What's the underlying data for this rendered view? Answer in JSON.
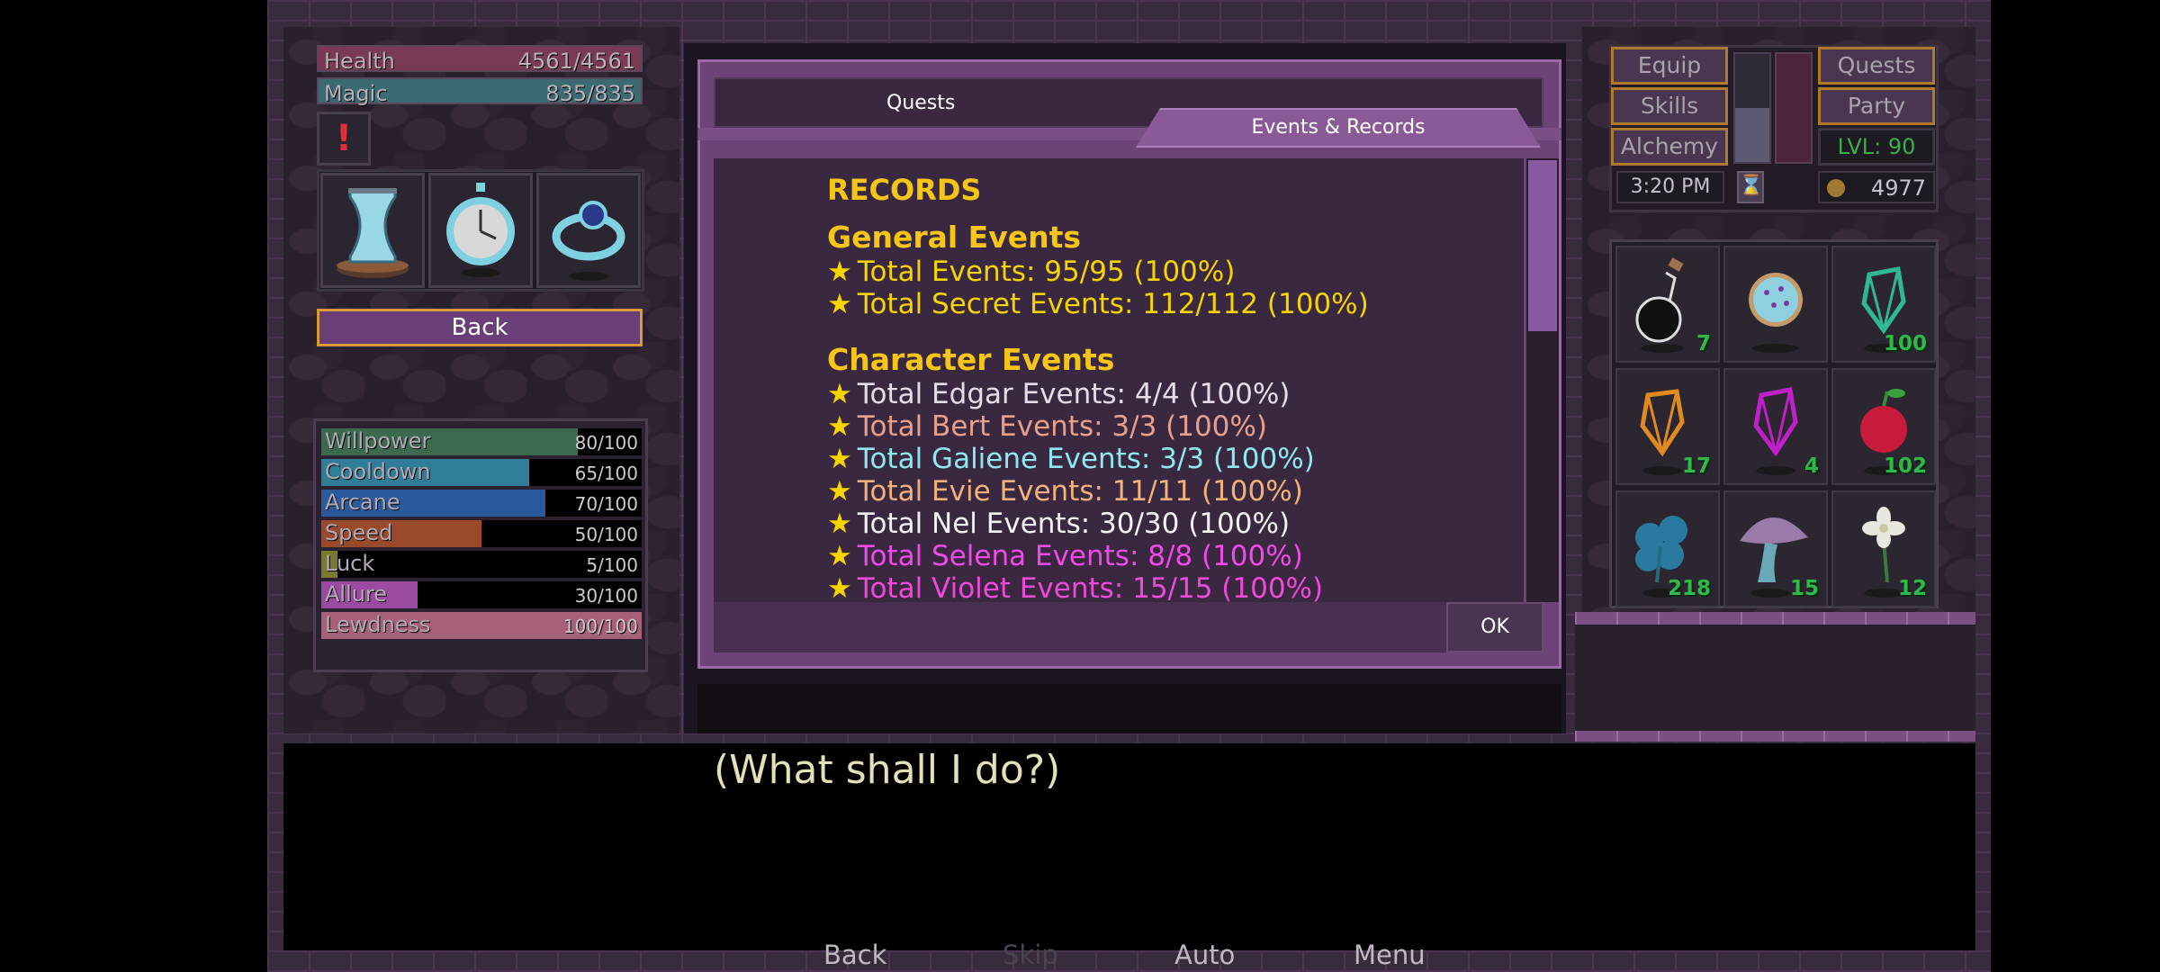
{
  "status": {
    "health": {
      "label": "Health",
      "value": "4561/4561",
      "fraction": 1.0,
      "color": "#7a3a55"
    },
    "magic": {
      "label": "Magic",
      "value": "835/835",
      "fraction": 1.0,
      "color": "#3c6a72"
    },
    "alert_icon": "exclamation-icon"
  },
  "equipped_items": [
    "hourglass-icon",
    "stopwatch-icon",
    "ring-icon"
  ],
  "back_button": "Back",
  "stats": [
    {
      "label": "Willpower",
      "value": "80/100",
      "fraction": 0.8,
      "color": "#3b6a4f"
    },
    {
      "label": "Cooldown",
      "value": "65/100",
      "fraction": 0.65,
      "color": "#2f7d96"
    },
    {
      "label": "Arcane",
      "value": "70/100",
      "fraction": 0.7,
      "color": "#2a5a9c"
    },
    {
      "label": "Speed",
      "value": "50/100",
      "fraction": 0.5,
      "color": "#9a4a2a"
    },
    {
      "label": "Luck",
      "value": "5/100",
      "fraction": 0.05,
      "color": "#7a7a30"
    },
    {
      "label": "Allure",
      "value": "30/100",
      "fraction": 0.3,
      "color": "#9a4aa0"
    },
    {
      "label": "Lewdness",
      "value": "100/100",
      "fraction": 1.0,
      "color": "#a6607a"
    }
  ],
  "right_menu": {
    "equip": "Equip",
    "quests": "Quests",
    "skills": "Skills",
    "party": "Party",
    "alchemy": "Alchemy",
    "level": "LVL: 90",
    "time": "3:20 PM",
    "gold": "4977"
  },
  "inventory": [
    {
      "icon": "potion-flask-icon",
      "count": "7"
    },
    {
      "icon": "cookie-icon",
      "count": ""
    },
    {
      "icon": "green-crystal-icon",
      "count": "100"
    },
    {
      "icon": "orange-crystal-icon",
      "count": "17"
    },
    {
      "icon": "purple-crystal-icon",
      "count": "4"
    },
    {
      "icon": "red-apple-icon",
      "count": "102"
    },
    {
      "icon": "blue-clover-icon",
      "count": "218"
    },
    {
      "icon": "mushroom-icon",
      "count": "15"
    },
    {
      "icon": "white-flower-icon",
      "count": "12"
    }
  ],
  "dialog": {
    "tab_quests": "Quests",
    "tab_events": "Events & Records",
    "title": "RECORDS",
    "section_general": "General Events",
    "general": [
      {
        "text": "Total Events: 95/95 (100%)",
        "color": "#f5d400"
      },
      {
        "text": "Total Secret Events: 112/112 (100%)",
        "color": "#f5d400"
      }
    ],
    "section_character": "Character Events",
    "character": [
      {
        "text": "Total Edgar Events: 4/4 (100%)",
        "color": "#e4dde6"
      },
      {
        "text": "Total Bert Events: 3/3 (100%)",
        "color": "#e9a08a"
      },
      {
        "text": "Total Galiene Events: 3/3 (100%)",
        "color": "#8fe8f0"
      },
      {
        "text": "Total Evie Events: 11/11 (100%)",
        "color": "#f0b27a"
      },
      {
        "text": "Total Nel Events: 30/30 (100%)",
        "color": "#f2f2f2"
      },
      {
        "text": "Total Selena Events: 8/8 (100%)",
        "color": "#f04ae8"
      },
      {
        "text": "Total Violet Events: 15/15 (100%)",
        "color": "#ee4ad8"
      }
    ],
    "ok": "OK"
  },
  "speech": "(What shall I do?)",
  "quick_menu": {
    "back": "Back",
    "skip": "Skip",
    "auto": "Auto",
    "menu": "Menu"
  }
}
